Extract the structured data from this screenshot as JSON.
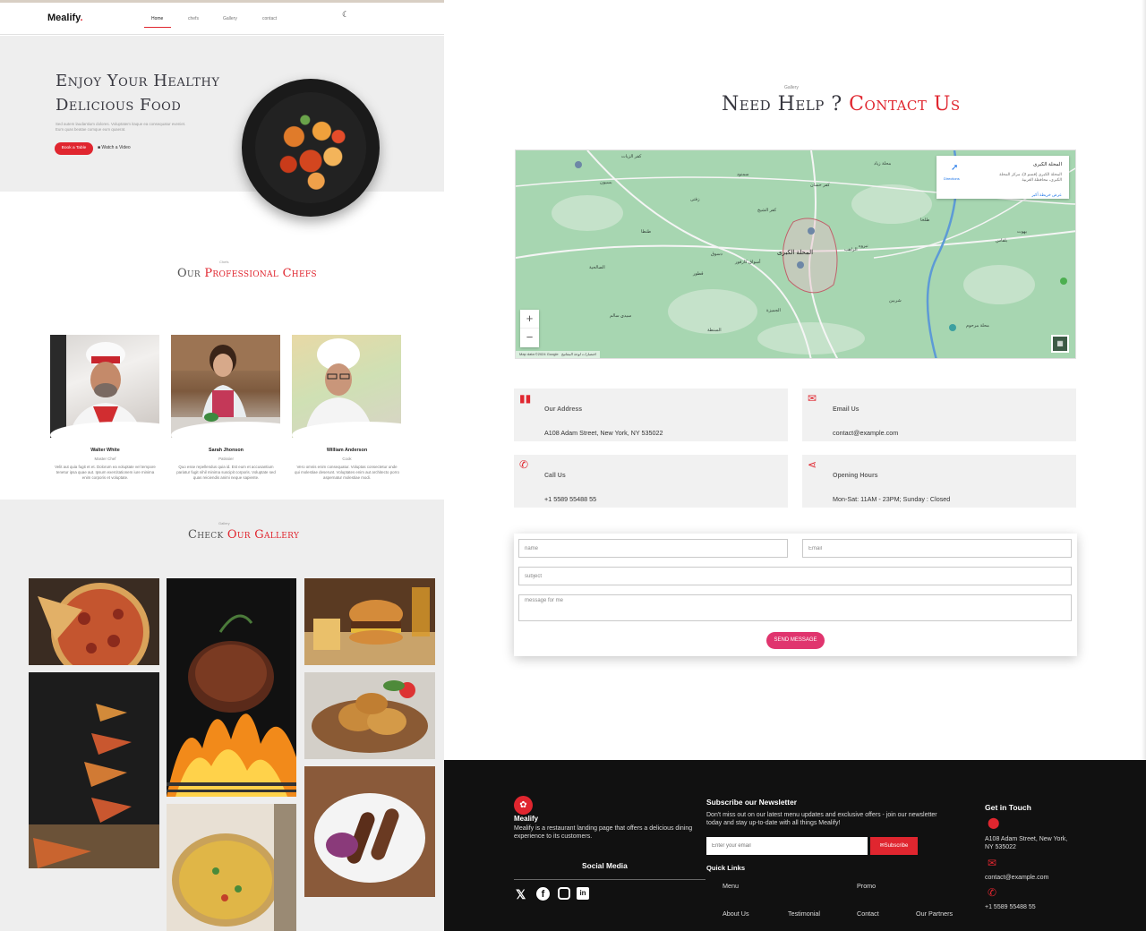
{
  "landing": {
    "brand": "Mealify",
    "brand_dot": ".",
    "nav": [
      "Home",
      "chefs",
      "Gallery",
      "contact"
    ],
    "hero": {
      "title_line1": "Enjoy Your Healthy",
      "title_line2": "Delicious Food",
      "subtitle": "Sed autem laudantium dolores. Voluptatem itaque ea consequatur eveniet. Eum quas beatae cumque eum quaerat.",
      "book_button": "Book a Table",
      "video_button": "Watch a Video"
    },
    "chefs_section": {
      "kicker": "Chefs",
      "title_part1": "Our ",
      "title_part2": "Professional Chefs",
      "chefs": [
        {
          "name": "Walter White",
          "role": "Master Chef",
          "desc": "Velit aut quia fugit et et. Dolorum ea voluptate vel tempore tenetur ipsa quae aut. Ipsum exercitationem iure minima enim corporis et voluptate."
        },
        {
          "name": "Sarah Jhonson",
          "role": "Patissier",
          "desc": "Quo esse repellendus quia id. Est eum et accusantium pariatur fugit nihil minima suscipit corporis. Voluptate sed quas reiciendis animi neque sapiente."
        },
        {
          "name": "William Anderson",
          "role": "Cook",
          "desc": "Vero omnis enim consequatur. Voluptas consectetur unde qui molestiae deserunt. Voluptates enim aut architecto porro aspernatur molestiae modi."
        }
      ]
    },
    "gallery_section": {
      "kicker": "Gallery",
      "title_part1": "Check ",
      "title_part2": "Our Gallery"
    }
  },
  "contact": {
    "kicker": "Gallery",
    "title_part1": "Need Help ? ",
    "title_part2": "Contact Us",
    "map": {
      "place_name": "المحلة الكبرى",
      "place_address": "المحلة الكبرى (قسم 2)، مركز المحلة الكبرى، محافظة الغربية",
      "larger_map": "عرض خريطة أكبر",
      "directions": "Directions",
      "footer": "Map data ©2024 Google",
      "footer_terms": "اختصارات لوحة المفاتيح",
      "city_label": "المحلة الكبرى",
      "labels": [
        "كفر الزيات",
        "سمنود",
        "بسيون",
        "طنطا",
        "زفتى",
        "الصالحية",
        "طلخا",
        "بلقاس",
        "شربين",
        "سيدي سالم",
        "قطور",
        "السنطة",
        "نبروه",
        "كفر الشيخ",
        "دسوق",
        "محلة مرحوم",
        "أسواق كارفور",
        "الراهب",
        "محلة زياد",
        "بهوت",
        "كفر حسان",
        "الجميزة"
      ]
    },
    "info": {
      "address_label": "Our Address",
      "address_value": "A108 Adam Street, New York, NY 535022",
      "email_label": "Email Us",
      "email_value": "contact@example.com",
      "call_label": "Call Us",
      "call_value": "+1 5589 55488 55",
      "hours_label": "Opening Hours",
      "hours_value": "Mon-Sat: 11AM - 23PM; Sunday : Closed"
    },
    "form": {
      "name_placeholder": "name",
      "email_placeholder": "Email",
      "subject_placeholder": "subject",
      "message_placeholder": "message for me",
      "send_label": "SEND MESSAGE"
    }
  },
  "footer": {
    "brand": "Mealify",
    "about": "Mealify is a restaurant landing page that offers a delicious dining experience to its customers.",
    "social_title": "Social Media",
    "newsletter_title": "Subscribe our Newsletter",
    "newsletter_desc": "Don't miss out on our latest menu updates and exclusive offers - join our newsletter today and stay up-to-date with all things Mealify!",
    "email_placeholder": "Enter your email",
    "subscribe_label": "Subscribe",
    "quick_links_title": "Quick Links",
    "links": [
      "Menu",
      "Promo",
      "About Us",
      "Testimonial",
      "Contact",
      "Our Partners"
    ],
    "get_in_touch_title": "Get in Touch",
    "address": "A108 Adam Street, New York, NY 535022",
    "email": "contact@example.com",
    "phone": "+1 5589 55488 55"
  },
  "colors": {
    "accent": "#e0262f",
    "send_button": "#e0356e",
    "footer_bg": "#111111",
    "map_green": "#a7d6b1"
  },
  "icons": [
    "moon-icon",
    "video-icon",
    "map-icon",
    "envelope-icon",
    "phone-icon",
    "share-icon",
    "location-pin-icon",
    "twitter-icon",
    "facebook-icon",
    "instagram-icon",
    "linkedin-icon"
  ]
}
